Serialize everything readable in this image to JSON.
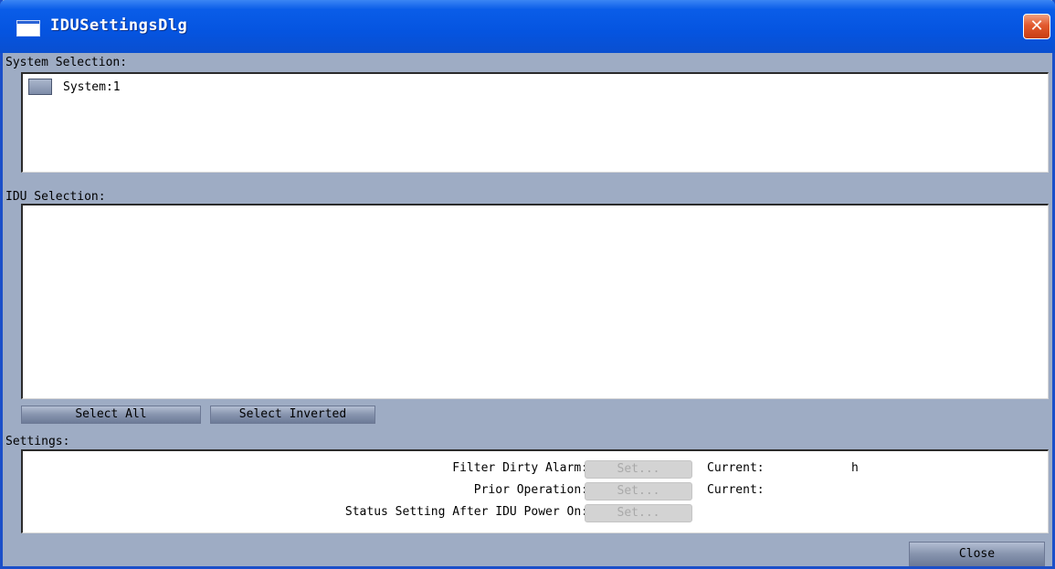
{
  "window": {
    "title": "IDUSettingsDlg",
    "close_symbol": "✕"
  },
  "system_selection": {
    "label": "System Selection:",
    "items": [
      {
        "label": "System:1"
      }
    ]
  },
  "idu_selection": {
    "label": "IDU Selection:"
  },
  "buttons": {
    "select_all": "Select All",
    "select_inverted": "Select Inverted",
    "close": "Close"
  },
  "settings": {
    "label": "Settings:",
    "rows": [
      {
        "label": "Filter Dirty Alarm:",
        "button": "Set...",
        "current_label": "Current:",
        "current_value": "h"
      },
      {
        "label": "Prior Operation:",
        "button": "Set...",
        "current_label": "Current:",
        "current_value": ""
      },
      {
        "label": "Status Setting After IDU Power On:",
        "button": "Set..."
      }
    ]
  },
  "colors": {
    "titlebar": "#0554e0",
    "dialog_bg": "#9eacc4",
    "close_button": "#e2592e"
  }
}
